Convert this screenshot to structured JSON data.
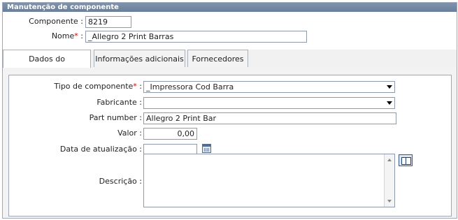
{
  "header": {
    "title": "Manutenção de componente"
  },
  "top_form": {
    "componente_label": "Componente :",
    "componente_value": "8219",
    "nome_label": "Nome",
    "nome_required": "*",
    "nome_colon": ":",
    "nome_value": "_Allegro 2 Print Barras"
  },
  "tabs": [
    {
      "label": "Dados do componente",
      "active": true
    },
    {
      "label": "Informações adicionais",
      "active": false
    },
    {
      "label": "Fornecedores",
      "active": false
    }
  ],
  "form": {
    "tipo_label": "Tipo de componente",
    "tipo_required": "*",
    "tipo_colon": ":",
    "tipo_value": "_Impressora Cod Barra",
    "fabricante_label": "Fabricante :",
    "fabricante_value": "",
    "part_label": "Part number :",
    "part_value": "Allegro 2 Print Bar",
    "valor_label": "Valor :",
    "valor_value": "0,00",
    "data_label": "Data de atualização :",
    "data_value": "",
    "descricao_label": "Descrição :",
    "descricao_value": ""
  },
  "icons": {
    "calendar": "calendar-icon",
    "book": "book-icon",
    "dropdown": "chevron-down-icon"
  },
  "colors": {
    "header_bg": "#6a7f9b",
    "required": "#d00000"
  }
}
